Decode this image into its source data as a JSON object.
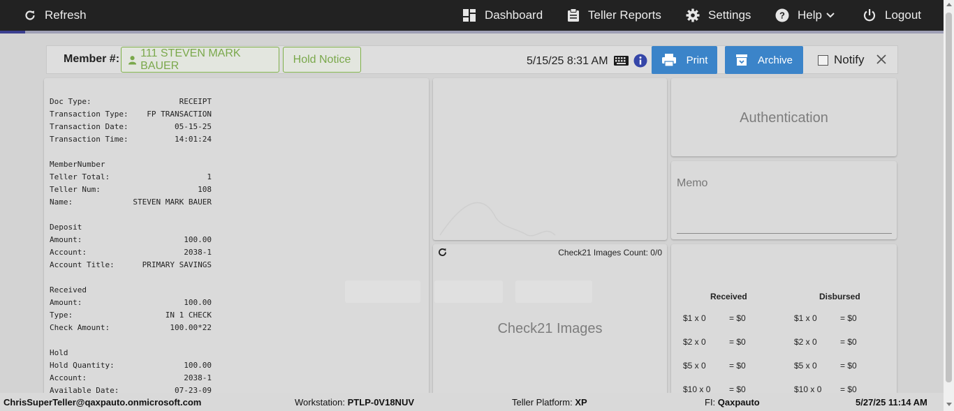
{
  "nav": {
    "refresh": "Refresh",
    "dashboard": "Dashboard",
    "teller_reports": "Teller Reports",
    "settings": "Settings",
    "help": "Help",
    "logout": "Logout"
  },
  "member_bar": {
    "label": "Member #:",
    "member_name": "111 STEVEN MARK BAUER",
    "hold_notice": "Hold Notice",
    "datetime": "5/15/25 8:31 AM",
    "print": "Print",
    "archive": "Archive",
    "notify": "Notify"
  },
  "receipt": {
    "lines": [
      {
        "k": "Doc Type:",
        "v": "RECEIPT"
      },
      {
        "k": "Transaction Type:",
        "v": "FP TRANSACTION"
      },
      {
        "k": "Transaction Date:",
        "v": "05-15-25"
      },
      {
        "k": "Transaction Time:",
        "v": "14:01:24"
      },
      {
        "k": "",
        "v": ""
      },
      {
        "k": "MemberNumber",
        "v": ""
      },
      {
        "k": "Teller Total:",
        "v": "1"
      },
      {
        "k": "Teller Num:",
        "v": "108"
      },
      {
        "k": "Name:",
        "v": "STEVEN MARK BAUER"
      },
      {
        "k": "",
        "v": ""
      },
      {
        "k": "Deposit",
        "v": ""
      },
      {
        "k": "Amount:",
        "v": "100.00"
      },
      {
        "k": "Account:",
        "v": "2038-1"
      },
      {
        "k": "Account Title:",
        "v": "PRIMARY SAVINGS"
      },
      {
        "k": "",
        "v": ""
      },
      {
        "k": "Received",
        "v": ""
      },
      {
        "k": "Amount:",
        "v": "100.00"
      },
      {
        "k": "Type:",
        "v": "IN 1 CHECK"
      },
      {
        "k": "Check Amount:",
        "v": "100.00*22"
      },
      {
        "k": "",
        "v": ""
      },
      {
        "k": "Hold",
        "v": ""
      },
      {
        "k": "Hold Quantity:",
        "v": "100.00"
      },
      {
        "k": "Account:",
        "v": "2038-1"
      },
      {
        "k": "Available Date:",
        "v": "07-23-09"
      }
    ]
  },
  "check21": {
    "count_label": "Check21 Images Count: 0/0",
    "title": "Check21 Images"
  },
  "authentication": {
    "title": "Authentication"
  },
  "memo": {
    "label": "Memo"
  },
  "cash": {
    "received_header": "Received",
    "disbursed_header": "Disbursed",
    "received": [
      {
        "denom": "$1 x 0",
        "total": "= $0"
      },
      {
        "denom": "$2 x 0",
        "total": "= $0"
      },
      {
        "denom": "$5 x 0",
        "total": "= $0"
      },
      {
        "denom": "$10 x 0",
        "total": "= $0"
      }
    ],
    "disbursed": [
      {
        "denom": "$1 x 0",
        "total": "= $0"
      },
      {
        "denom": "$2 x 0",
        "total": "= $0"
      },
      {
        "denom": "$5 x 0",
        "total": "= $0"
      },
      {
        "denom": "$10 x 0",
        "total": "= $0"
      }
    ]
  },
  "status_bar": {
    "user": "ChrisSuperTeller@qaxpauto.onmicrosoft.com",
    "workstation_label": "Workstation:",
    "workstation": "PTLP-0V18NUV",
    "platform_label": "Teller Platform:",
    "platform": "XP",
    "fi_label": "FI:",
    "fi": "Qaxpauto",
    "datetime": "5/27/25 11:14 AM"
  },
  "colors": {
    "nav_bg": "#222222",
    "blue_button": "#3b84c9",
    "green_outline": "#7fb04a",
    "page_bg": "#d3d3d3"
  }
}
